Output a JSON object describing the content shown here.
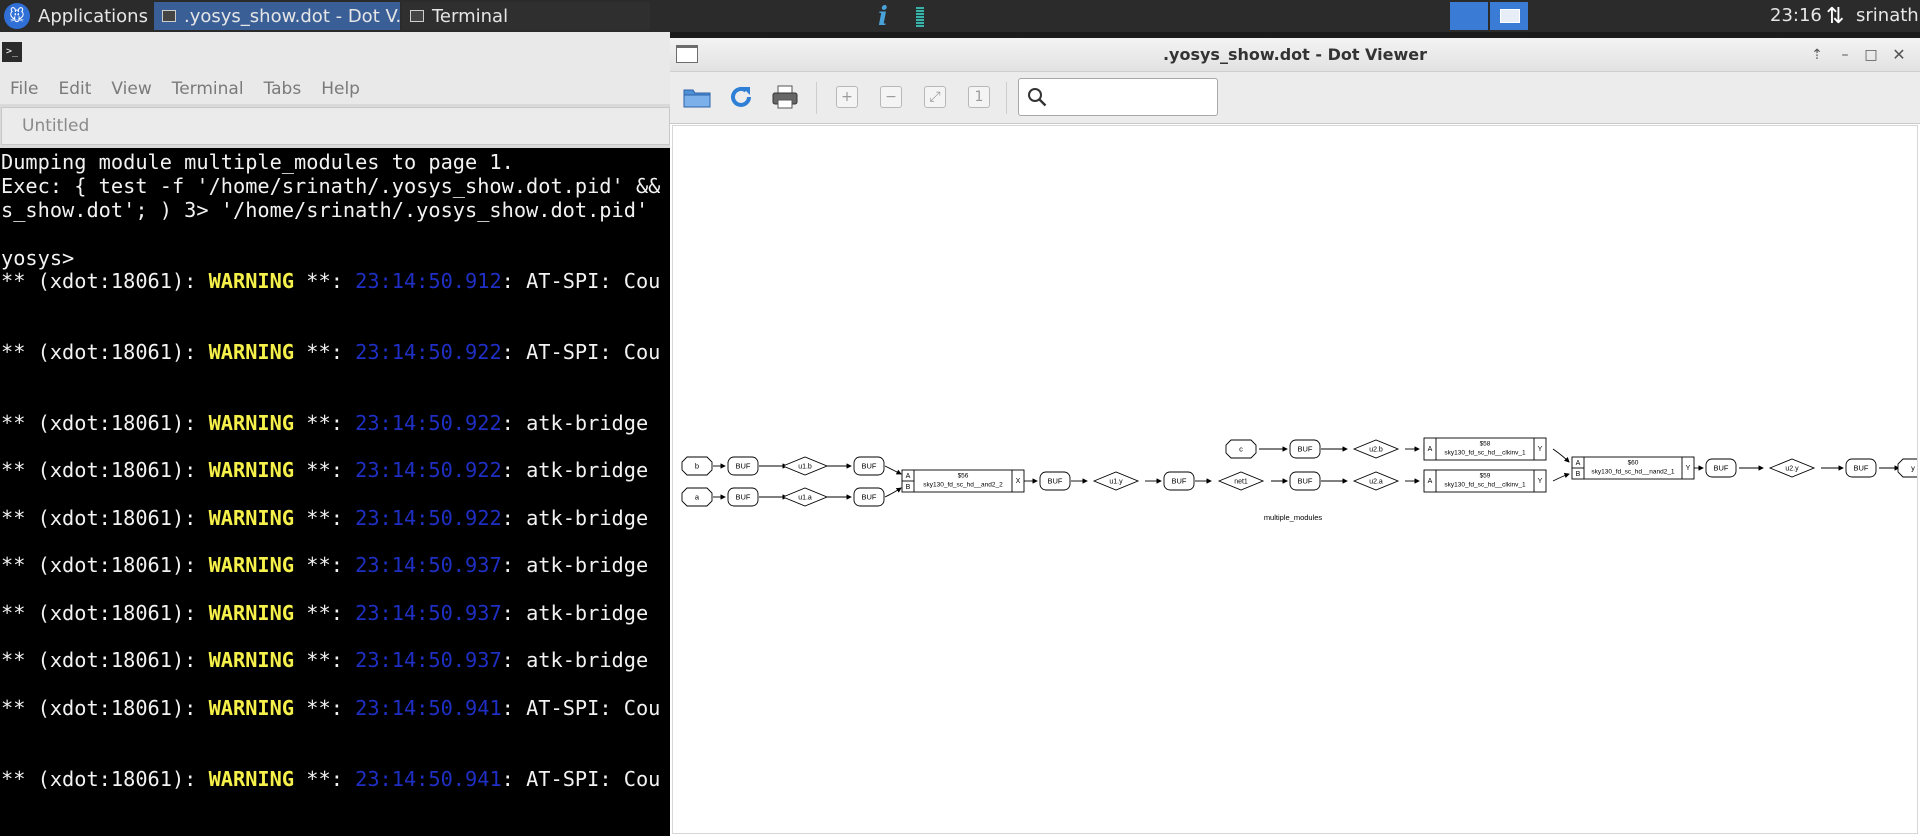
{
  "panel": {
    "applications_label": "Applications",
    "tasks": [
      {
        "label": ".yosys_show.dot - Dot V...",
        "active": true
      },
      {
        "label": "Terminal",
        "active": false
      }
    ],
    "clock": "23:16",
    "user": "srinath",
    "icons": [
      "xfce-logo-icon",
      "info-icon",
      "cpu-graph-icon",
      "network-icon"
    ]
  },
  "terminal": {
    "menu": [
      "File",
      "Edit",
      "View",
      "Terminal",
      "Tabs",
      "Help"
    ],
    "tab_label": "Untitled",
    "lines": [
      "Dumping module multiple_modules to page 1.",
      "Exec: { test -f '/home/srinath/.yosys_show.dot.pid' &&",
      "s_show.dot'; ) 3> '/home/srinath/.yosys_show.dot.pid'",
      "yosys>"
    ],
    "warnings": [
      {
        "prefix": "** (xdot:18061): ",
        "level": "WARNING",
        "sep": " **: ",
        "time": "23:14:50.912",
        "msg": ": AT-SPI: Cou"
      },
      {
        "prefix": "** (xdot:18061): ",
        "level": "WARNING",
        "sep": " **: ",
        "time": "23:14:50.922",
        "msg": ": AT-SPI: Cou"
      },
      {
        "prefix": "** (xdot:18061): ",
        "level": "WARNING",
        "sep": " **: ",
        "time": "23:14:50.922",
        "msg": ": atk-bridge"
      },
      {
        "prefix": "** (xdot:18061): ",
        "level": "WARNING",
        "sep": " **: ",
        "time": "23:14:50.922",
        "msg": ": atk-bridge"
      },
      {
        "prefix": "** (xdot:18061): ",
        "level": "WARNING",
        "sep": " **: ",
        "time": "23:14:50.922",
        "msg": ": atk-bridge"
      },
      {
        "prefix": "** (xdot:18061): ",
        "level": "WARNING",
        "sep": " **: ",
        "time": "23:14:50.937",
        "msg": ": atk-bridge"
      },
      {
        "prefix": "** (xdot:18061): ",
        "level": "WARNING",
        "sep": " **: ",
        "time": "23:14:50.937",
        "msg": ": atk-bridge"
      },
      {
        "prefix": "** (xdot:18061): ",
        "level": "WARNING",
        "sep": " **: ",
        "time": "23:14:50.937",
        "msg": ": atk-bridge"
      },
      {
        "prefix": "** (xdot:18061): ",
        "level": "WARNING",
        "sep": " **: ",
        "time": "23:14:50.941",
        "msg": ": AT-SPI: Cou"
      },
      {
        "prefix": "** (xdot:18061): ",
        "level": "WARNING",
        "sep": " **: ",
        "time": "23:14:50.941",
        "msg": ": AT-SPI: Cou"
      }
    ]
  },
  "viewer": {
    "title": ".yosys_show.dot - Dot Viewer",
    "toolbar_icons": [
      "open-folder-icon",
      "reload-icon",
      "print-icon",
      "zoom-in-icon",
      "zoom-out-icon",
      "zoom-fit-icon",
      "zoom-100-icon"
    ],
    "search_placeholder": "",
    "graph": {
      "caption": "multiple_modules",
      "nodes": [
        {
          "shape": "octagon",
          "label": "b"
        },
        {
          "shape": "octagon",
          "label": "a"
        },
        {
          "shape": "rounded",
          "label": "BUF"
        },
        {
          "shape": "rounded",
          "label": "BUF"
        },
        {
          "shape": "diamond",
          "label": "u1.b"
        },
        {
          "shape": "diamond",
          "label": "u1.a"
        },
        {
          "shape": "rounded",
          "label": "BUF"
        },
        {
          "shape": "rounded",
          "label": "BUF"
        },
        {
          "shape": "cell",
          "ports_in": [
            "A",
            "B"
          ],
          "name": "$56",
          "type": "sky130_fd_sc_hd__and2_2",
          "ports_out": [
            "X"
          ]
        },
        {
          "shape": "rounded",
          "label": "BUF"
        },
        {
          "shape": "diamond",
          "label": "u1.y"
        },
        {
          "shape": "rounded",
          "label": "BUF"
        },
        {
          "shape": "diamond",
          "label": "net1"
        },
        {
          "shape": "octagon",
          "label": "c"
        },
        {
          "shape": "rounded",
          "label": "BUF"
        },
        {
          "shape": "rounded",
          "label": "BUF"
        },
        {
          "shape": "diamond",
          "label": "u2.b"
        },
        {
          "shape": "diamond",
          "label": "u2.a"
        },
        {
          "shape": "rounded",
          "label": "BUF"
        },
        {
          "shape": "rounded",
          "label": "BUF"
        },
        {
          "shape": "cell",
          "ports_in": [
            "A"
          ],
          "name": "$58",
          "type": "sky130_fd_sc_hd__clkinv_1",
          "ports_out": [
            "Y"
          ]
        },
        {
          "shape": "cell",
          "ports_in": [
            "A"
          ],
          "name": "$59",
          "type": "sky130_fd_sc_hd__clkinv_1",
          "ports_out": [
            "Y"
          ]
        },
        {
          "shape": "cell",
          "ports_in": [
            "A",
            "B"
          ],
          "name": "$60",
          "type": "sky130_fd_sc_hd__nand2_1",
          "ports_out": [
            "Y"
          ]
        },
        {
          "shape": "rounded",
          "label": "BUF"
        },
        {
          "shape": "diamond",
          "label": "u2.y"
        },
        {
          "shape": "rounded",
          "label": "BUF"
        },
        {
          "shape": "octagon",
          "label": "y"
        }
      ]
    }
  },
  "colors": {
    "warning": "#f6f04a",
    "timestamp": "#1f2fc4",
    "panel": "#2b2b2b",
    "active_task": "#3a5f97",
    "workspace": "#3a7bd5"
  }
}
